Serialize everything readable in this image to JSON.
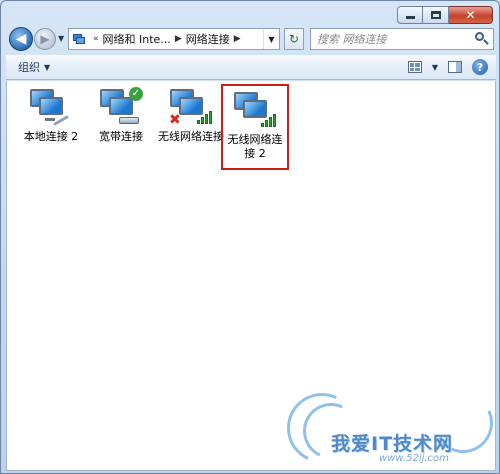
{
  "window": {
    "caption": {
      "min_icon": "minimize-icon",
      "max_icon": "maximize-icon",
      "close_glyph": "✕"
    }
  },
  "nav": {
    "back_glyph": "◀",
    "forward_glyph": "▶",
    "address": {
      "prefix": "«",
      "crumbs": [
        "网络和 Inte...",
        "网络连接"
      ],
      "sep": "▶"
    },
    "refresh_glyph": "↻",
    "search_placeholder": "搜索 网络连接"
  },
  "toolbar": {
    "organize_label": "组织",
    "help_glyph": "?"
  },
  "connections": [
    {
      "label": "本地连接 2",
      "type": "lan"
    },
    {
      "label": "宽带连接",
      "type": "broadband"
    },
    {
      "label": "无线网络连接",
      "type": "wireless-disconnected"
    },
    {
      "label": "无线网络连接 2",
      "type": "wireless",
      "highlighted": true
    }
  ],
  "watermark": {
    "text": "我爱IT技术网",
    "url": "www.52ij.com"
  },
  "colors": {
    "highlight_border": "#c81e1e",
    "signal_green": "#38a33c",
    "error_red": "#d52b1e",
    "watermark_blue": "#4f89c8"
  }
}
